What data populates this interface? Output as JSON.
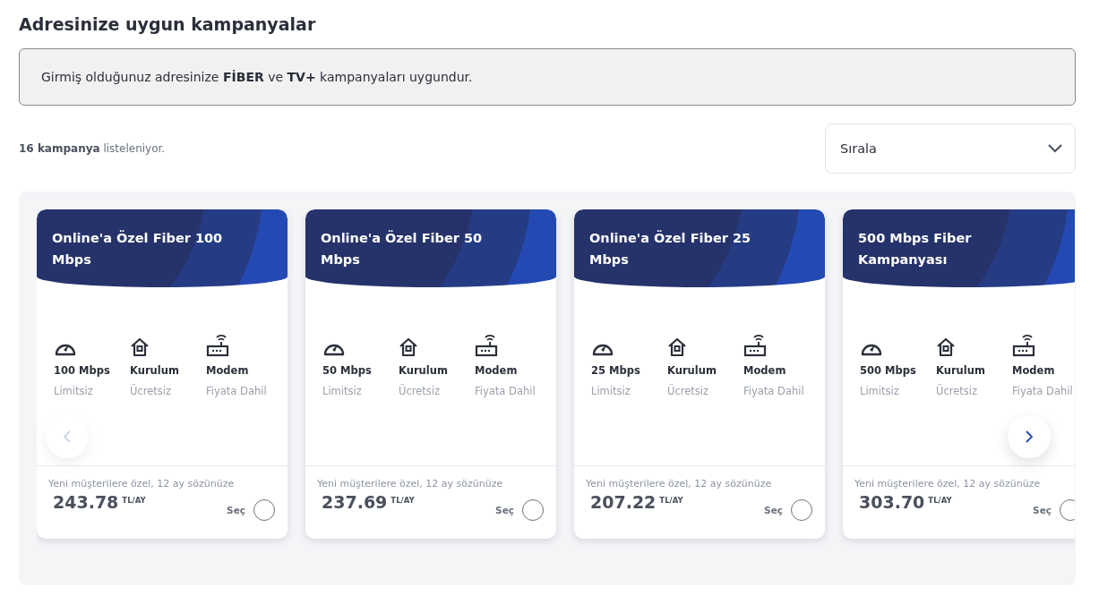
{
  "heading": "Adresinize uygun kampanyalar",
  "notice": "Girmiş olduğunuz adresinize **FİBER** ve **TV+** kampanyaları uygundur.",
  "count": "**16 kampanya** listeleniyor.",
  "sort": {
    "label": "Sırala"
  },
  "carousel_nav": [
    {
      "kind": "prev",
      "disabled": true
    },
    {
      "kind": "next",
      "disabled": false
    }
  ],
  "campaigns": [
    {
      "title": "Online'a Özel Fiber 100 Mbps",
      "features": [
        {
          "kind": "speed",
          "title": "100 Mbps",
          "subtitle": "Limitsiz"
        },
        {
          "kind": "installation",
          "title": "Kurulum",
          "subtitle": "Ücretsiz"
        },
        {
          "kind": "modem",
          "title": "Modem",
          "subtitle": "Fiyata Dahil"
        }
      ],
      "note": "Yeni müşterilere özel, 12 ay sözünüze",
      "price": "243.78",
      "unit": "TL/AY",
      "select_label": "Seç",
      "selected": false
    },
    {
      "title": "Online'a Özel Fiber 50 Mbps",
      "features": [
        {
          "kind": "speed",
          "title": "50 Mbps",
          "subtitle": "Limitsiz"
        },
        {
          "kind": "installation",
          "title": "Kurulum",
          "subtitle": "Ücretsiz"
        },
        {
          "kind": "modem",
          "title": "Modem",
          "subtitle": "Fiyata Dahil"
        }
      ],
      "note": "Yeni müşterilere özel, 12 ay sözünüze",
      "price": "237.69",
      "unit": "TL/AY",
      "select_label": "Seç",
      "selected": false
    },
    {
      "title": "Online'a Özel Fiber 25 Mbps",
      "features": [
        {
          "kind": "speed",
          "title": "25 Mbps",
          "subtitle": "Limitsiz"
        },
        {
          "kind": "installation",
          "title": "Kurulum",
          "subtitle": "Ücretsiz"
        },
        {
          "kind": "modem",
          "title": "Modem",
          "subtitle": "Fiyata Dahil"
        }
      ],
      "note": "Yeni müşterilere özel, 12 ay sözünüze",
      "price": "207.22",
      "unit": "TL/AY",
      "select_label": "Seç",
      "selected": false
    },
    {
      "title": "500 Mbps Fiber Kampanyası",
      "features": [
        {
          "kind": "speed",
          "title": "500 Mbps",
          "subtitle": "Limitsiz"
        },
        {
          "kind": "installation",
          "title": "Kurulum",
          "subtitle": "Ücretsiz"
        },
        {
          "kind": "modem",
          "title": "Modem",
          "subtitle": "Fiyata Dahil"
        }
      ],
      "note": "Yeni müşterilere özel, 12 ay sözünüze",
      "price": "303.70",
      "unit": "TL/AY",
      "select_label": "Seç",
      "selected": false
    }
  ]
}
